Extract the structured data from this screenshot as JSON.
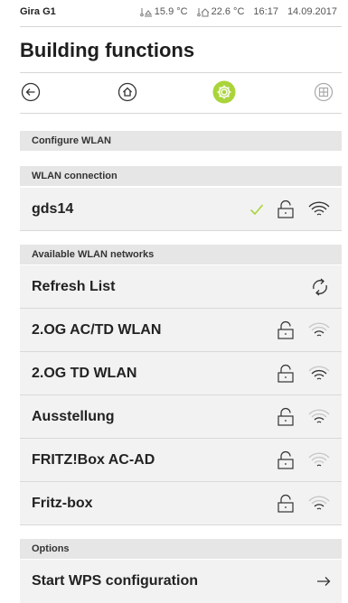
{
  "status": {
    "device": "Gira G1",
    "outdoor_temp": "15.9 °C",
    "indoor_temp": "22.6 °C",
    "time": "16:17",
    "date": "14.09.2017"
  },
  "page_title": "Building functions",
  "sections": {
    "configure": "Configure WLAN",
    "connection": "WLAN connection",
    "available": "Available WLAN networks",
    "options": "Options"
  },
  "connection": {
    "name": "gds14"
  },
  "refresh_label": "Refresh List",
  "networks": [
    {
      "name": "2.OG AC/TD WLAN",
      "signal": 2
    },
    {
      "name": "2.OG TD WLAN",
      "signal": 3
    },
    {
      "name": "Ausstellung",
      "signal": 2
    },
    {
      "name": "FRITZ!Box AC-AD",
      "signal": 1
    },
    {
      "name": "Fritz-box",
      "signal": 2
    }
  ],
  "wps_label": "Start WPS configuration",
  "colors": {
    "accent": "#a9d43a",
    "check": "#a9d43a"
  }
}
